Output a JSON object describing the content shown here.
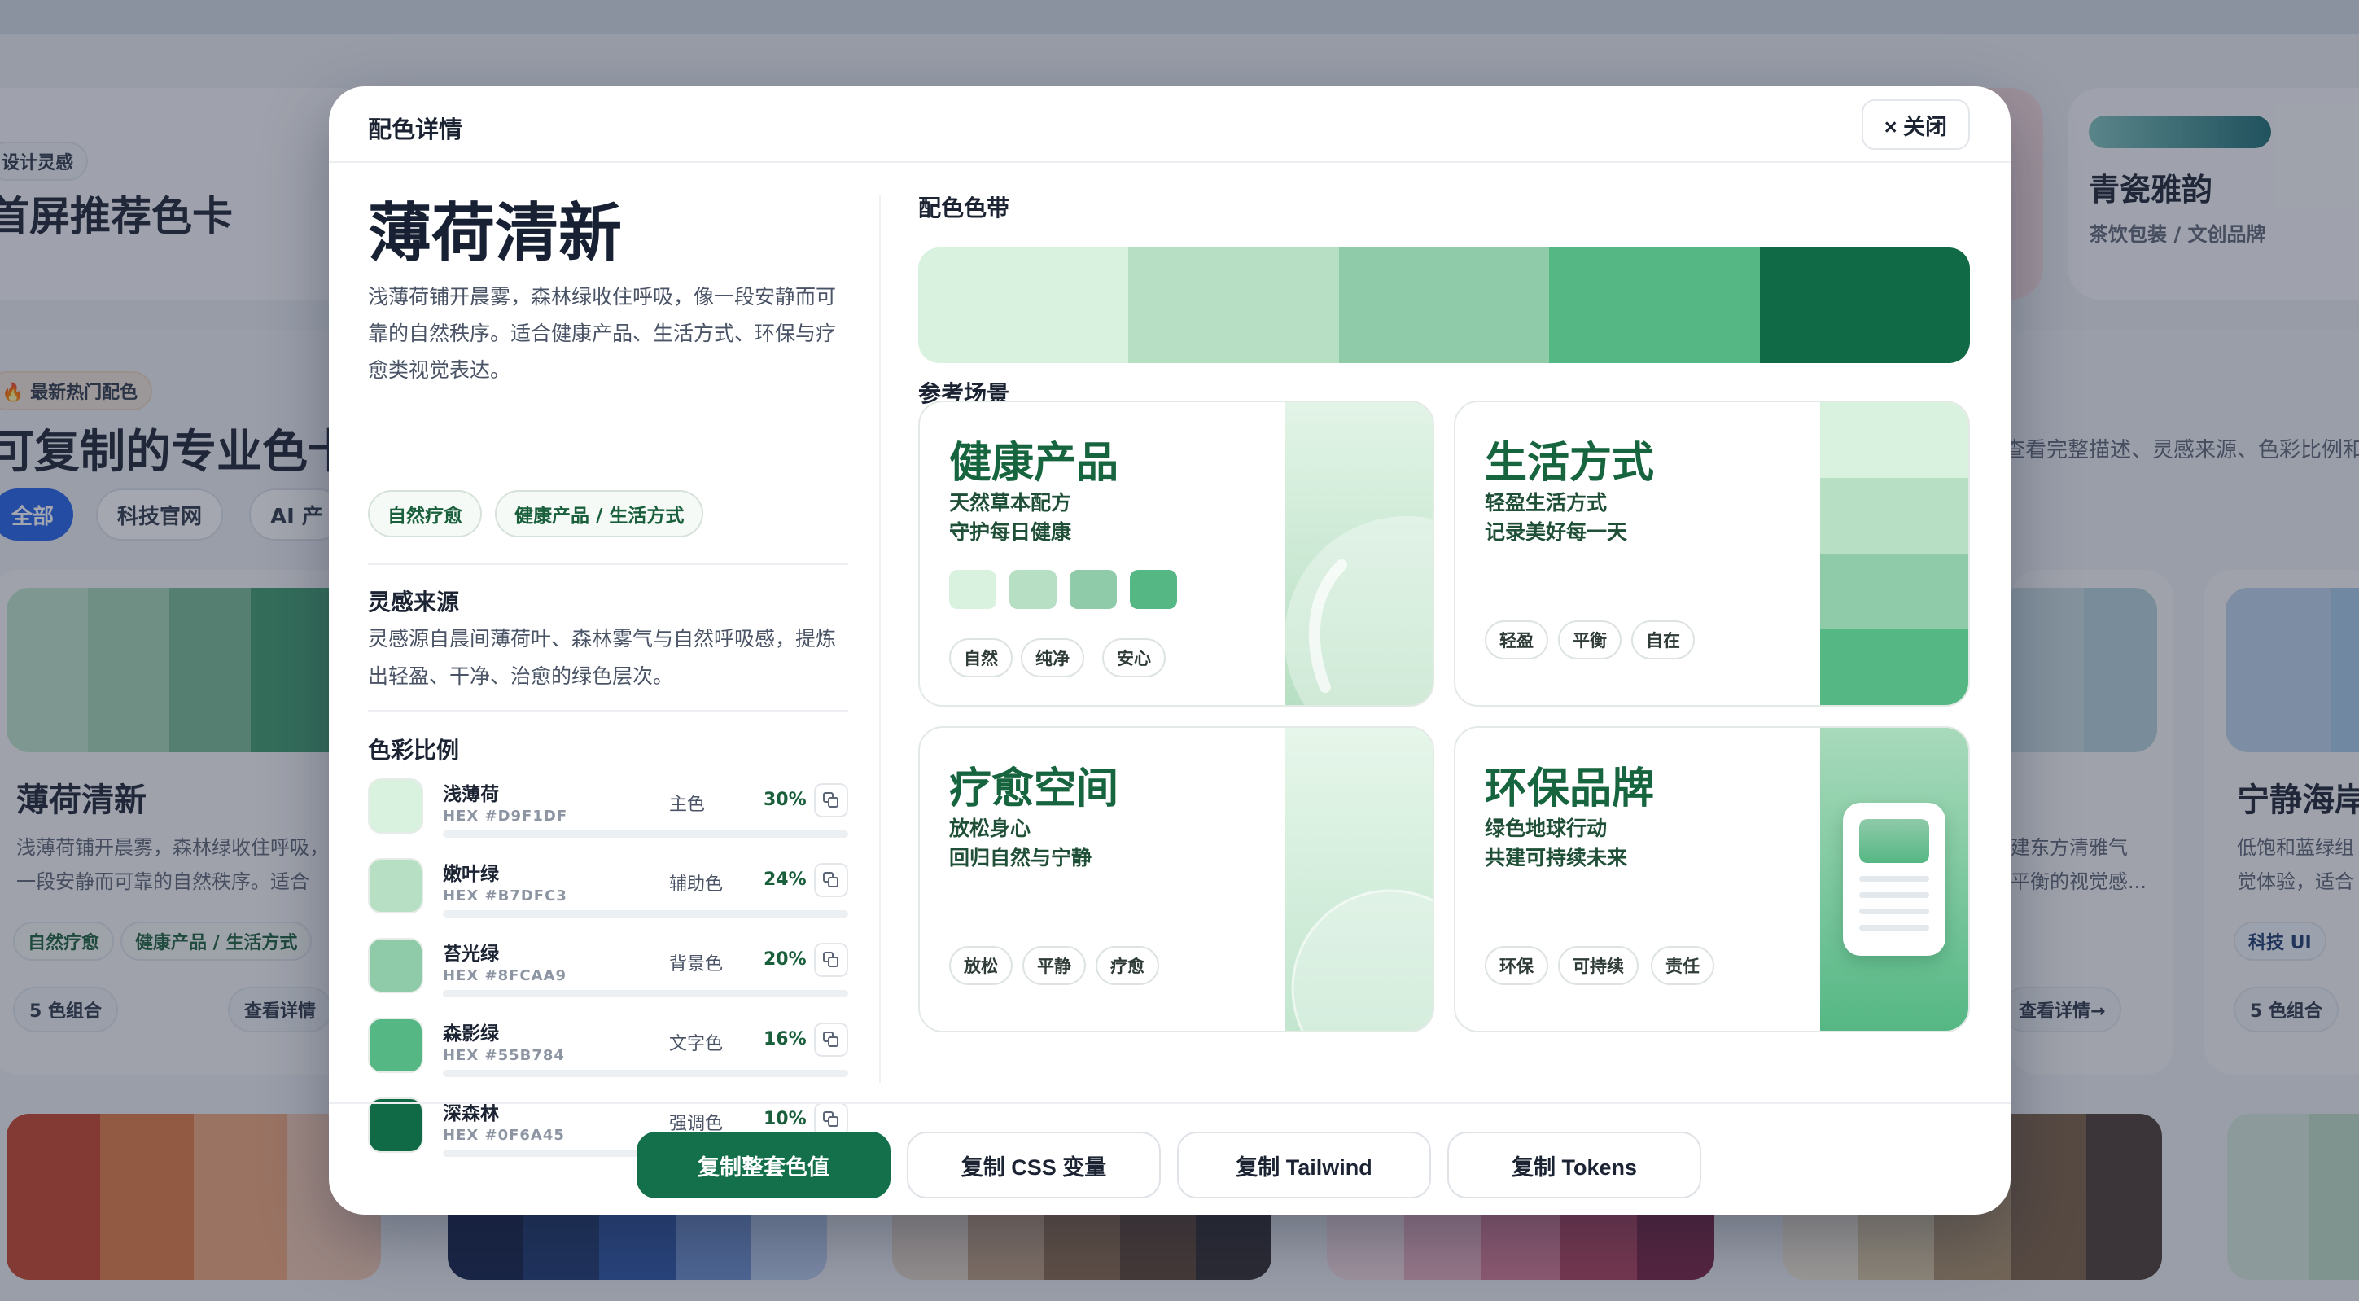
{
  "background": {
    "hero_chip": "设计灵感",
    "hero_title": "首屏推荐色卡",
    "side_card": {
      "title": "青瓷雅韵",
      "subtitle": "茶饮包装 / 文创品牌"
    },
    "hot_chip": "最新热门配色",
    "section_title": "可复制的专业色卡",
    "section_hint": "查看完整描述、灵感来源、色彩比例和",
    "filters": [
      "全部",
      "科技官网",
      "AI 产"
    ],
    "cards": [
      {
        "title": "薄荷清新",
        "desc_line1": "浅薄荷铺开晨雾，森林绿收住呼吸，",
        "desc_line2": "一段安静而可靠的自然秩序。适合",
        "tags": [
          "自然疗愈",
          "健康产品 / 生活方式"
        ],
        "count": "5 色组合",
        "link": "查看详情"
      },
      {
        "desc_line1": "建东方清雅气",
        "desc_line2": "平衡的视觉感...",
        "link": "查看详情→"
      },
      {
        "title": "宁静海岸",
        "desc_line1": "低饱和蓝绿组",
        "desc_line2": "觉体验，适合",
        "tags": [
          "科技 UI"
        ],
        "count": "5 色组合"
      }
    ]
  },
  "modal": {
    "title": "配色详情",
    "close_label": "× 关闭",
    "palette_name": "薄荷清新",
    "palette_desc": "浅薄荷铺开晨雾，森林绿收住呼吸，像一段安静而可靠的自然秩序。适合健康产品、生活方式、环保与疗愈类视觉表达。",
    "tags": [
      "自然疗愈",
      "健康产品 / 生活方式"
    ],
    "source_heading": "灵感来源",
    "source_text": "灵感源自晨间薄荷叶、森林雾气与自然呼吸感，提炼出轻盈、干净、治愈的绿色层次。",
    "ratio_heading": "色彩比例",
    "colors": [
      {
        "name": "浅薄荷",
        "hex": "HEX #D9F1DF",
        "role": "主色",
        "percent": "30%",
        "ratio": 0.3,
        "color": "#D9F1DF"
      },
      {
        "name": "嫩叶绿",
        "hex": "HEX #B7DFC3",
        "role": "辅助色",
        "percent": "24%",
        "ratio": 0.24,
        "color": "#B7DFC3"
      },
      {
        "name": "苔光绿",
        "hex": "HEX #8FCAA9",
        "role": "背景色",
        "percent": "20%",
        "ratio": 0.2,
        "color": "#8FCAA9"
      },
      {
        "name": "森影绿",
        "hex": "HEX #55B784",
        "role": "文字色",
        "percent": "16%",
        "ratio": 0.16,
        "color": "#55B784"
      },
      {
        "name": "深森林",
        "hex": "HEX #0F6A45",
        "role": "强调色",
        "percent": "10%",
        "ratio": 0.1,
        "color": "#0F6A45"
      }
    ],
    "band_heading": "配色色带",
    "scene_heading": "参考场景",
    "scenes": [
      {
        "title": "健康产品",
        "line1": "天然草本配方",
        "line2": "守护每日健康",
        "pills": [
          "自然",
          "纯净",
          "安心"
        ]
      },
      {
        "title": "生活方式",
        "line1": "轻盈生活方式",
        "line2": "记录美好每一天",
        "pills": [
          "轻盈",
          "平衡",
          "自在"
        ]
      },
      {
        "title": "疗愈空间",
        "line1": "放松身心",
        "line2": "回归自然与宁静",
        "pills": [
          "放松",
          "平静",
          "疗愈"
        ]
      },
      {
        "title": "环保品牌",
        "line1": "绿色地球行动",
        "line2": "共建可持续未来",
        "pills": [
          "环保",
          "可持续",
          "责任"
        ]
      }
    ],
    "footer_buttons": [
      "复制整套色值",
      "复制 CSS 变量",
      "复制 Tailwind",
      "复制 Tokens"
    ]
  }
}
